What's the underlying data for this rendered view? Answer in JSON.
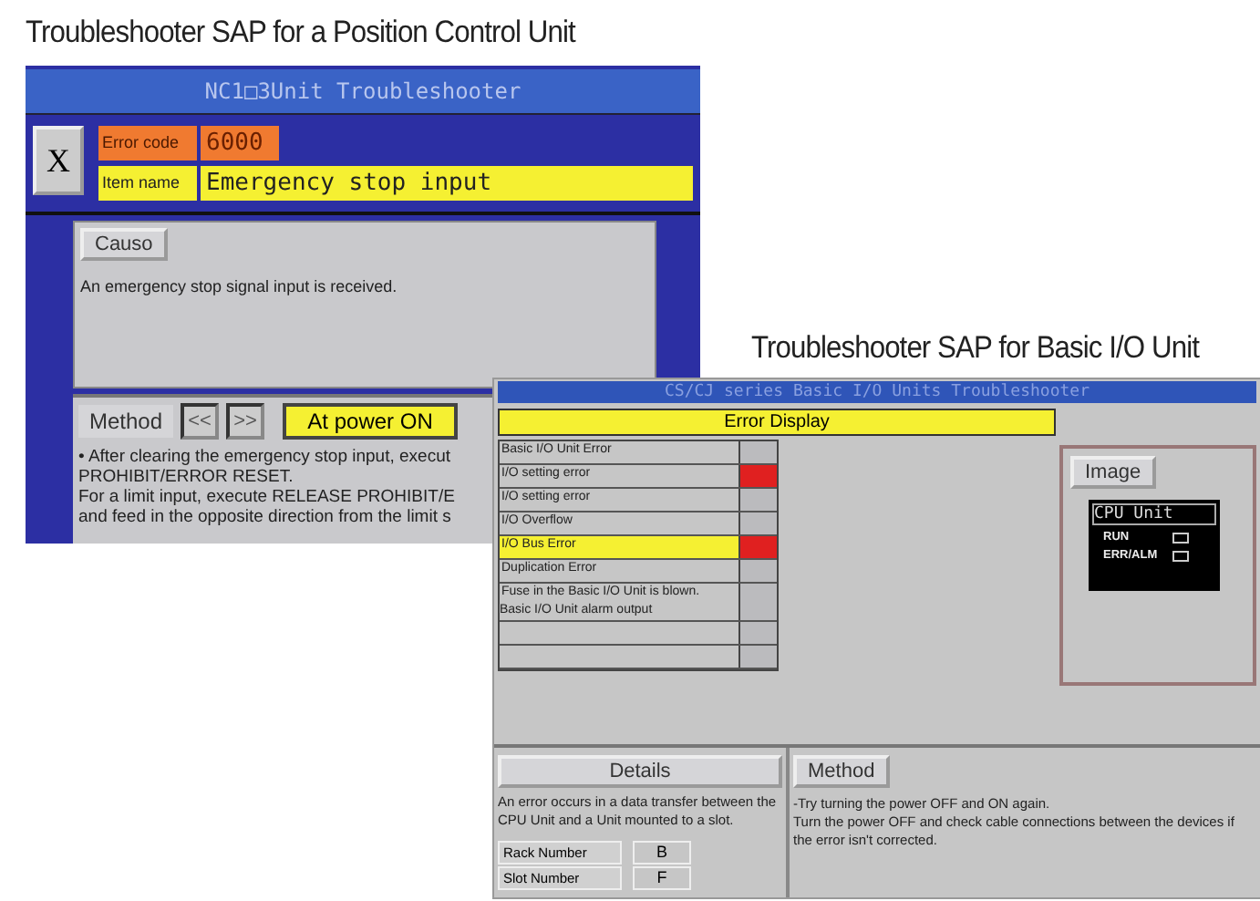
{
  "captions": [
    "Troubleshooter SAP for a Position Control Unit",
    "Troubleshooter SAP for Basic I/O Unit"
  ],
  "position_window": {
    "title": "NC1□3Unit Troubleshooter",
    "close_button": "X",
    "error_code_label": "Error code",
    "error_code": "6000",
    "item_name_label": "Item name",
    "item_name": "Emergency stop input",
    "cause": {
      "button": "Causo",
      "text": "An emergency stop signal input is received."
    },
    "method": {
      "label": "Method",
      "prev": "<<",
      "next": ">>",
      "tabs": [
        {
          "label": "At power ON",
          "selected": true
        }
      ],
      "lines": [
        "• After clearing the emergency stop input, execut",
        "PROHIBIT/ERROR RESET.",
        "For a limit input, execute RELEASE PROHIBIT/E",
        "and feed in the opposite direction from the limit s"
      ]
    }
  },
  "io_window": {
    "title": "CS/CJ series Basic I/O Units Troubleshooter",
    "header": "Error Display",
    "rows": [
      {
        "label": "Basic I/O Unit Error",
        "selected": false,
        "error": false
      },
      {
        "label": "I/O setting error",
        "selected": false,
        "error": true
      },
      {
        "label": "I/O setting error",
        "selected": false,
        "error": false
      },
      {
        "label": "I/O Overflow",
        "selected": false,
        "error": false
      },
      {
        "label": "I/O Bus Error",
        "selected": true,
        "error": true
      },
      {
        "label": "Duplication Error",
        "selected": false,
        "error": false
      },
      {
        "label": "Fuse in the Basic I/O Unit is blown.\nBasic I/O Unit alarm output",
        "selected": false,
        "error": false
      },
      {
        "label": "",
        "selected": false,
        "error": false
      },
      {
        "label": "",
        "selected": false,
        "error": false
      }
    ],
    "image": {
      "button": "Image",
      "display_title": "CPU Unit",
      "leds": [
        "RUN",
        "ERR/ALM"
      ]
    },
    "details": {
      "button": "Details",
      "text": "An error occurs in a data transfer between the CPU Unit  and a Unit mounted to a slot.",
      "fields": [
        {
          "label": "Rack Number",
          "value": "B"
        },
        {
          "label": "Slot Number",
          "value": "F"
        }
      ]
    },
    "method": {
      "button": "Method",
      "text": "-Try turning the power OFF and ON again.\n Turn the power OFF and check cable connections between the devices if the error isn't corrected."
    }
  }
}
